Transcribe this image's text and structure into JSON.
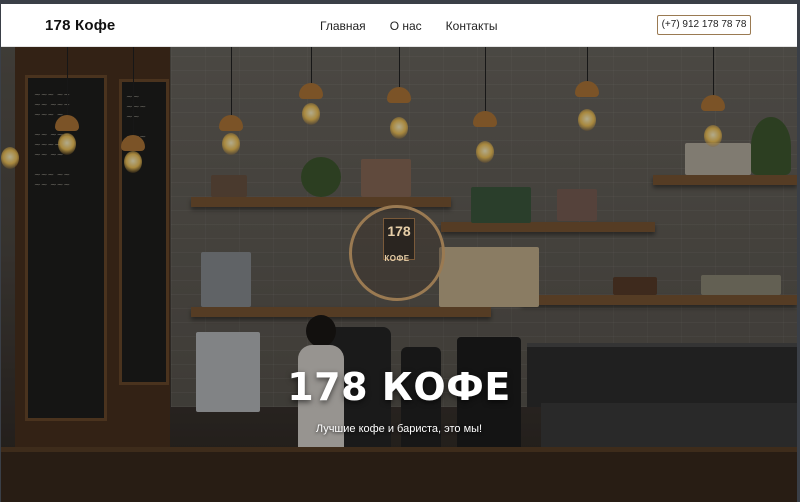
{
  "header": {
    "brand": "178 Кофе",
    "nav": [
      {
        "label": "Главная"
      },
      {
        "label": "О нас"
      },
      {
        "label": "Контакты"
      }
    ],
    "phone": "(+7) 912 178 78 78"
  },
  "hero": {
    "emblem": {
      "number": "178",
      "word": "КОФЕ"
    },
    "title": "178 КОФЕ",
    "subtitle": "Лучшие кофе и бариста, это мы!"
  },
  "colors": {
    "accent": "#9a7a52",
    "header_bg": "#ffffff",
    "hero_text": "#ffffff"
  }
}
